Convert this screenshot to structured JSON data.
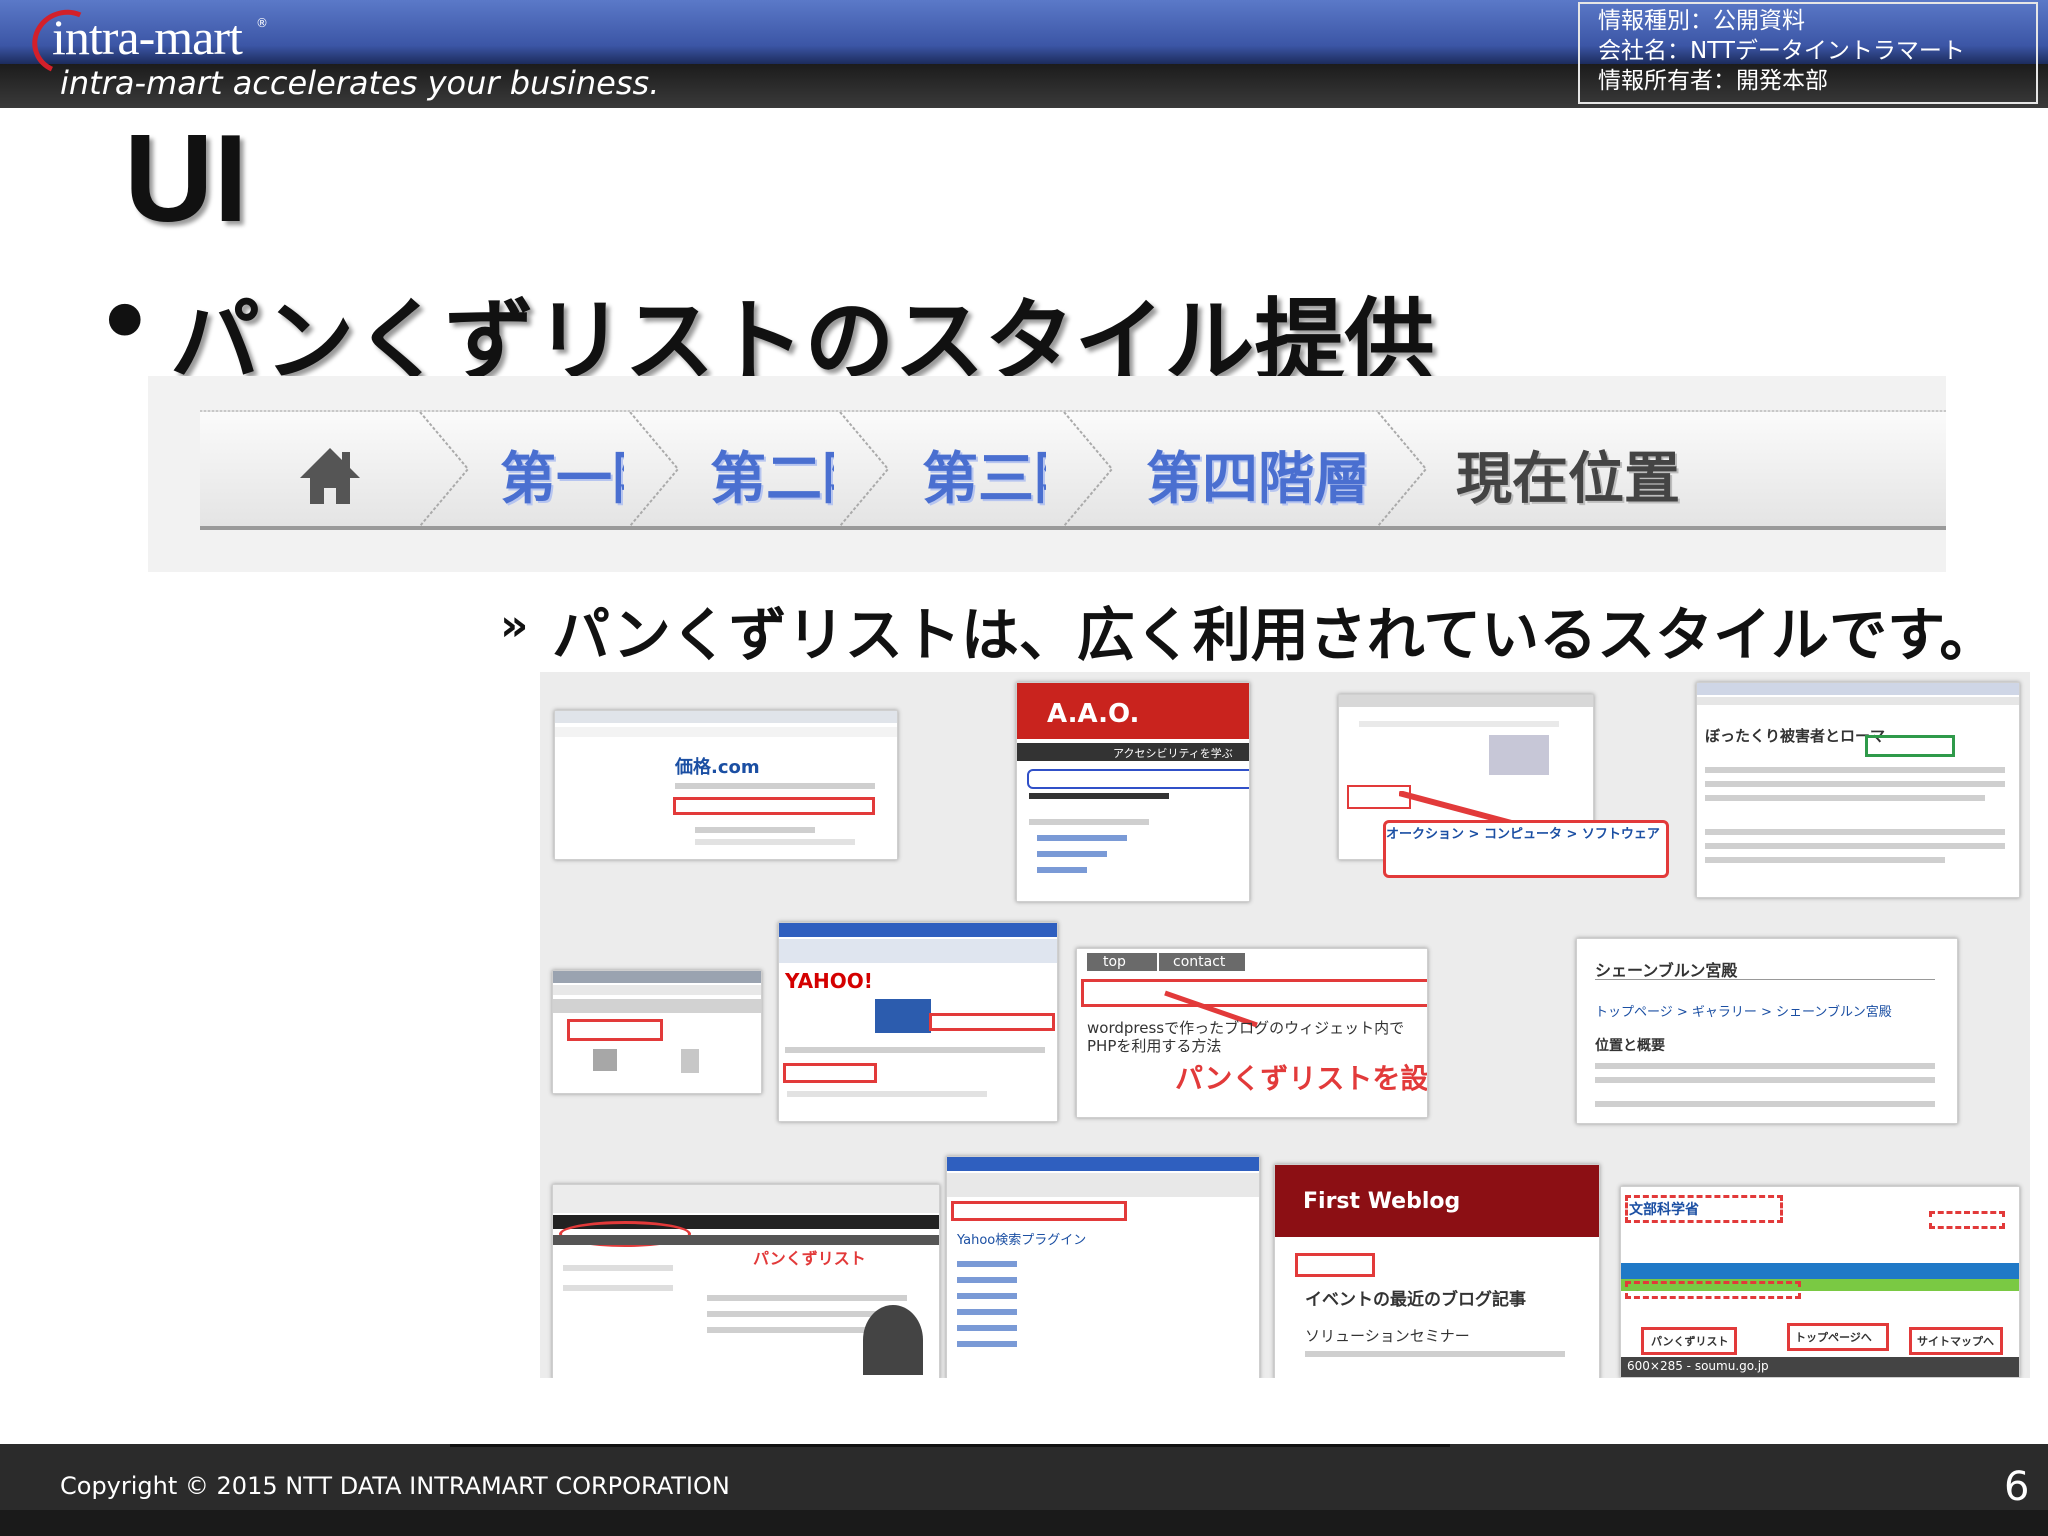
{
  "header": {
    "logo_text": "intra-mart",
    "logo_mark": "®",
    "tagline": "intra-mart accelerates your business.",
    "info_lines": [
      "情報種別：公開資料",
      "会社名：NTTデータイントラマート",
      "情報所有者：開発本部"
    ]
  },
  "slide": {
    "title": "UI",
    "bullet_marker": "•",
    "bullet": "パンくずリストのスタイル提供",
    "sub_marker": "»",
    "sub_bullet": "パンくずリストは、広く利用されているスタイルです。"
  },
  "breadcrumb": {
    "home_icon": "home-icon",
    "items": [
      "第一階層",
      "第二階層",
      "第三階層",
      "第四階層"
    ],
    "current": "現在位置"
  },
  "collage": {
    "kakaku_logo": "価格.com",
    "aao_title": "A.A.O.",
    "aao_nav": "アクセシビリティを学ぶ",
    "site_crumb": "オークション > コンピュータ > ソフトウェア",
    "article_title": "ぼったくり被害者とローマ",
    "yahoo_logo": "YAHOO!",
    "wp_tabs": [
      "top",
      "contact"
    ],
    "wp_title": "wordpressで作ったブログのウィジェット内でPHPを利用する方法",
    "wp_caption": "パンくずリストを設置！",
    "palace_title": "シェーンブルン宮殿",
    "palace_crumb": "トップページ > ギャラリー > シェーンブルン宮殿",
    "palace_sub": "位置と概要",
    "mydesign_caption": "パンくずリスト",
    "plugin_text": "Yahoo検索プラグイン",
    "weblog_title": "First Weblog",
    "weblog_sub": "イベントの最近のブログ記事",
    "weblog_line": "ソリューションセミナー",
    "mext_logo": "文部科学省",
    "mext_labels": [
      "パンくずリスト",
      "トップページへ",
      "サイトマップへ"
    ],
    "mext_size": "600×285 - soumu.go.jp"
  },
  "footer": {
    "copyright": "Copyright © 2015 NTT DATA INTRAMART CORPORATION",
    "page_number": "6"
  },
  "colors": {
    "header_blue": "#3c56a6",
    "breadcrumb_link": "#4a6fd0",
    "annotation_red": "#e23a3a",
    "footer_bg": "#2b2b2b"
  }
}
